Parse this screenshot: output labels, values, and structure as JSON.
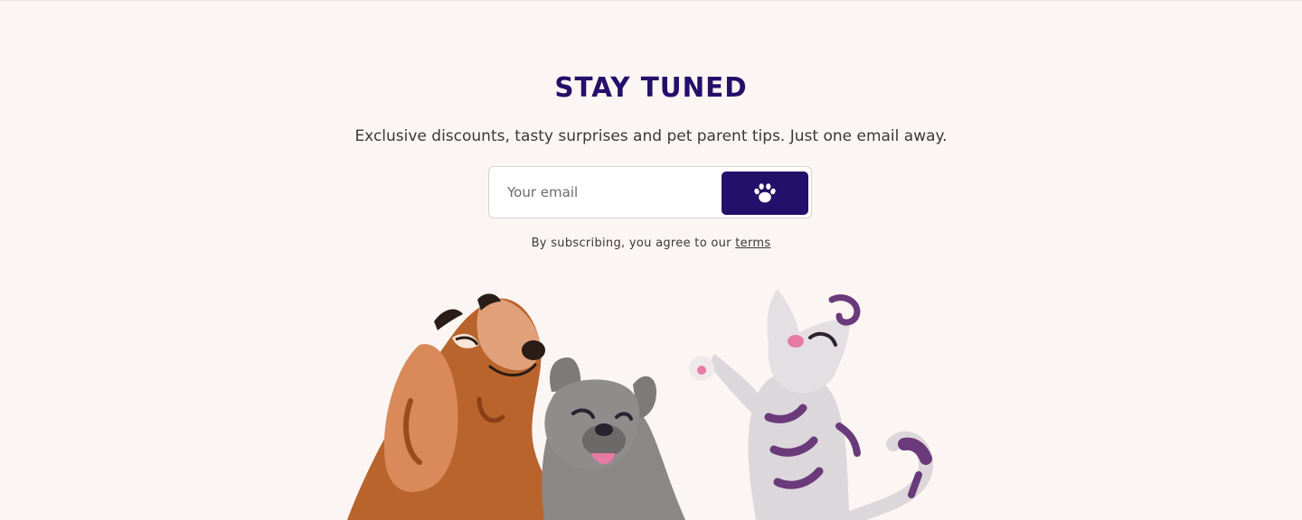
{
  "newsletter": {
    "title": "STAY TUNED",
    "subtitle": "Exclusive discounts, tasty surprises and pet parent tips. Just one email away.",
    "email_placeholder": "Your email",
    "submit_icon": "paw-icon",
    "legal_prefix": "By subscribing, you agree to our ",
    "terms_link": "terms"
  },
  "colors": {
    "background": "#fbf6f3",
    "accent": "#23106a",
    "text": "#3b3838"
  },
  "illustration": {
    "subjects": [
      "dog-spaniel",
      "dog-french-bulldog",
      "cat-striped"
    ]
  }
}
